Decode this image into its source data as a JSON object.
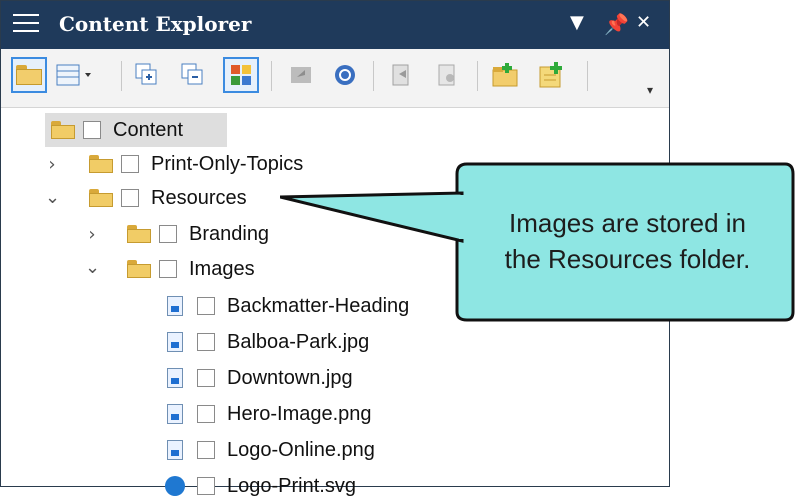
{
  "window": {
    "title": "Content Explorer",
    "dropdown_icon": "▼",
    "pin_icon": "📌",
    "close_icon": "✕"
  },
  "toolbar": {
    "buttons": [
      {
        "name": "open-folder-button"
      },
      {
        "name": "view-options-button"
      },
      {
        "name": "expand-all-button"
      },
      {
        "name": "collapse-all-button"
      },
      {
        "name": "color-grid-button"
      },
      {
        "name": "send-back-button"
      },
      {
        "name": "refresh-button"
      },
      {
        "name": "open-file-button"
      },
      {
        "name": "doc-tools-button"
      },
      {
        "name": "new-folder-button"
      },
      {
        "name": "add-file-button"
      }
    ]
  },
  "tree": {
    "root": "Content",
    "items": [
      {
        "label": "Print-Only-Topics"
      },
      {
        "label": "Resources"
      },
      {
        "label": "Branding"
      },
      {
        "label": "Images"
      },
      {
        "label": "Backmatter-Heading"
      },
      {
        "label": "Balboa-Park.jpg"
      },
      {
        "label": "Downtown.jpg"
      },
      {
        "label": "Hero-Image.png"
      },
      {
        "label": "Logo-Online.png"
      },
      {
        "label": "Logo-Print.svg"
      }
    ]
  },
  "callout": {
    "text_line1": "Images are stored in",
    "text_line2": "the Resources folder."
  }
}
